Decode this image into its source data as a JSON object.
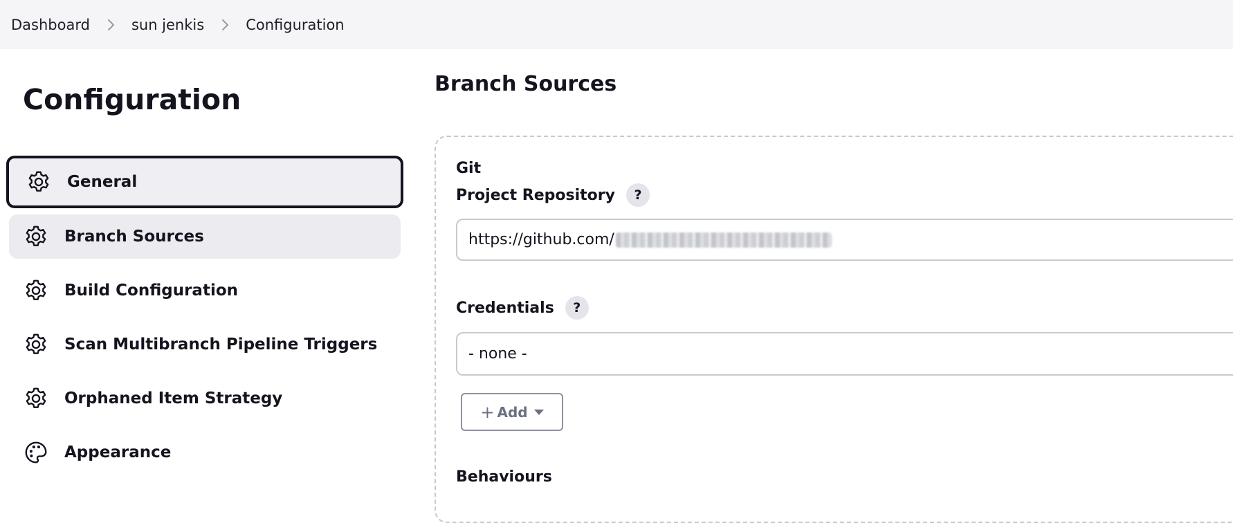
{
  "breadcrumb": {
    "items": [
      "Dashboard",
      "sun jenkis",
      "Configuration"
    ]
  },
  "page_title": "Configuration",
  "sidebar": {
    "items": [
      {
        "label": "General",
        "icon": "gear-icon",
        "state": "active"
      },
      {
        "label": "Branch Sources",
        "icon": "gear-icon",
        "state": "selected"
      },
      {
        "label": "Build Configuration",
        "icon": "gear-icon"
      },
      {
        "label": "Scan Multibranch Pipeline Triggers",
        "icon": "gear-icon"
      },
      {
        "label": "Orphaned Item Strategy",
        "icon": "gear-icon"
      },
      {
        "label": "Appearance",
        "icon": "palette-icon"
      }
    ]
  },
  "main": {
    "section_title": "Branch Sources",
    "git": {
      "heading": "Git",
      "project_repository_label": "Project Repository",
      "project_repository_value": "https://github.com/",
      "credentials_label": "Credentials",
      "credentials_value": "- none -",
      "add_button_label": "Add",
      "behaviours_label": "Behaviours"
    }
  },
  "colors": {
    "topbar_bg": "#f5f5f8",
    "active_border": "#14141f",
    "selected_bg": "#ebebf0",
    "help_bg": "#e4e4ea",
    "dashed_border": "#c3c9d0"
  }
}
